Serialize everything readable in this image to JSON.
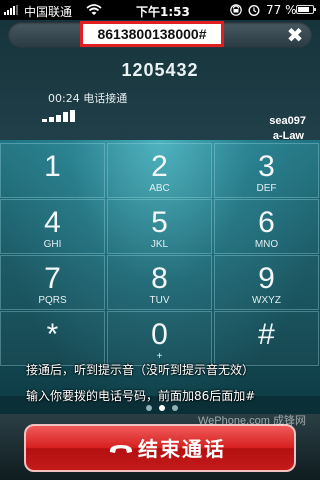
{
  "status_bar": {
    "carrier": "中国联通",
    "time": "下午1:53",
    "battery_percent": "77 %",
    "battery_level": 0.77,
    "icons": [
      "signal-icon",
      "wifi-icon",
      "lock-icon",
      "alarm-icon",
      "battery-icon"
    ]
  },
  "call": {
    "dialed_number": "8613800138000#",
    "caller_number_partial": "1205432",
    "duration_text": "00:24 电话接通",
    "account": "sea097",
    "codec": "a-Law",
    "clear_icon": "close-icon"
  },
  "keypad": {
    "keys": [
      {
        "digit": "1",
        "letters": ""
      },
      {
        "digit": "2",
        "letters": "ABC"
      },
      {
        "digit": "3",
        "letters": "DEF"
      },
      {
        "digit": "4",
        "letters": "GHI"
      },
      {
        "digit": "5",
        "letters": "JKL"
      },
      {
        "digit": "6",
        "letters": "MNO"
      },
      {
        "digit": "7",
        "letters": "PQRS"
      },
      {
        "digit": "8",
        "letters": "TUV"
      },
      {
        "digit": "9",
        "letters": "WXYZ"
      },
      {
        "digit": "*",
        "letters": ""
      },
      {
        "digit": "0",
        "letters": "+"
      },
      {
        "digit": "#",
        "letters": ""
      }
    ]
  },
  "instructions": {
    "line1": "接通后，听到提示音（没听到提示音无效）",
    "line2": "输入你要拨的电话号码，前面加86后面加#"
  },
  "pager": {
    "count": 3,
    "active": 1
  },
  "watermark": "WePhone.com 成锋网",
  "end_call": {
    "label": "结束通话",
    "icon": "hangup-icon"
  },
  "colors": {
    "end_button": "#d61f1f",
    "highlight_box": "#e02020",
    "keypad": "#1e7280"
  }
}
